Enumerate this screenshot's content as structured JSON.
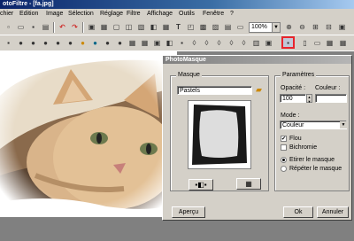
{
  "app": {
    "title": "otoFiltre - [fa.jpg]"
  },
  "menu": [
    "chier",
    "Edition",
    "Image",
    "Sélection",
    "Réglage",
    "Filtre",
    "Affichage",
    "Outils",
    "Fenêtre",
    "?"
  ],
  "toolbar": {
    "zoom_value": "100%"
  },
  "dialog": {
    "title": "PhotoMasque",
    "masque_group_label": "Masque",
    "mask_name": "Pastels",
    "params_group_label": "Paramètres",
    "opacity_label": "Opacité :",
    "opacity_value": "100",
    "color_label": "Couleur :",
    "mode_label": "Mode :",
    "mode_value": "Couleur",
    "flou_label": "Flou",
    "flou_checked": "✔",
    "bichromie_label": "Bichromie",
    "etirer_label": "Etirer le masque",
    "repeter_label": "Répéter le masque",
    "apercu_label": "Aperçu",
    "ok_label": "Ok",
    "annuler_label": "Annuler"
  },
  "colors": {
    "highlight": "#e8242c",
    "titlebar": "#0a246a"
  }
}
